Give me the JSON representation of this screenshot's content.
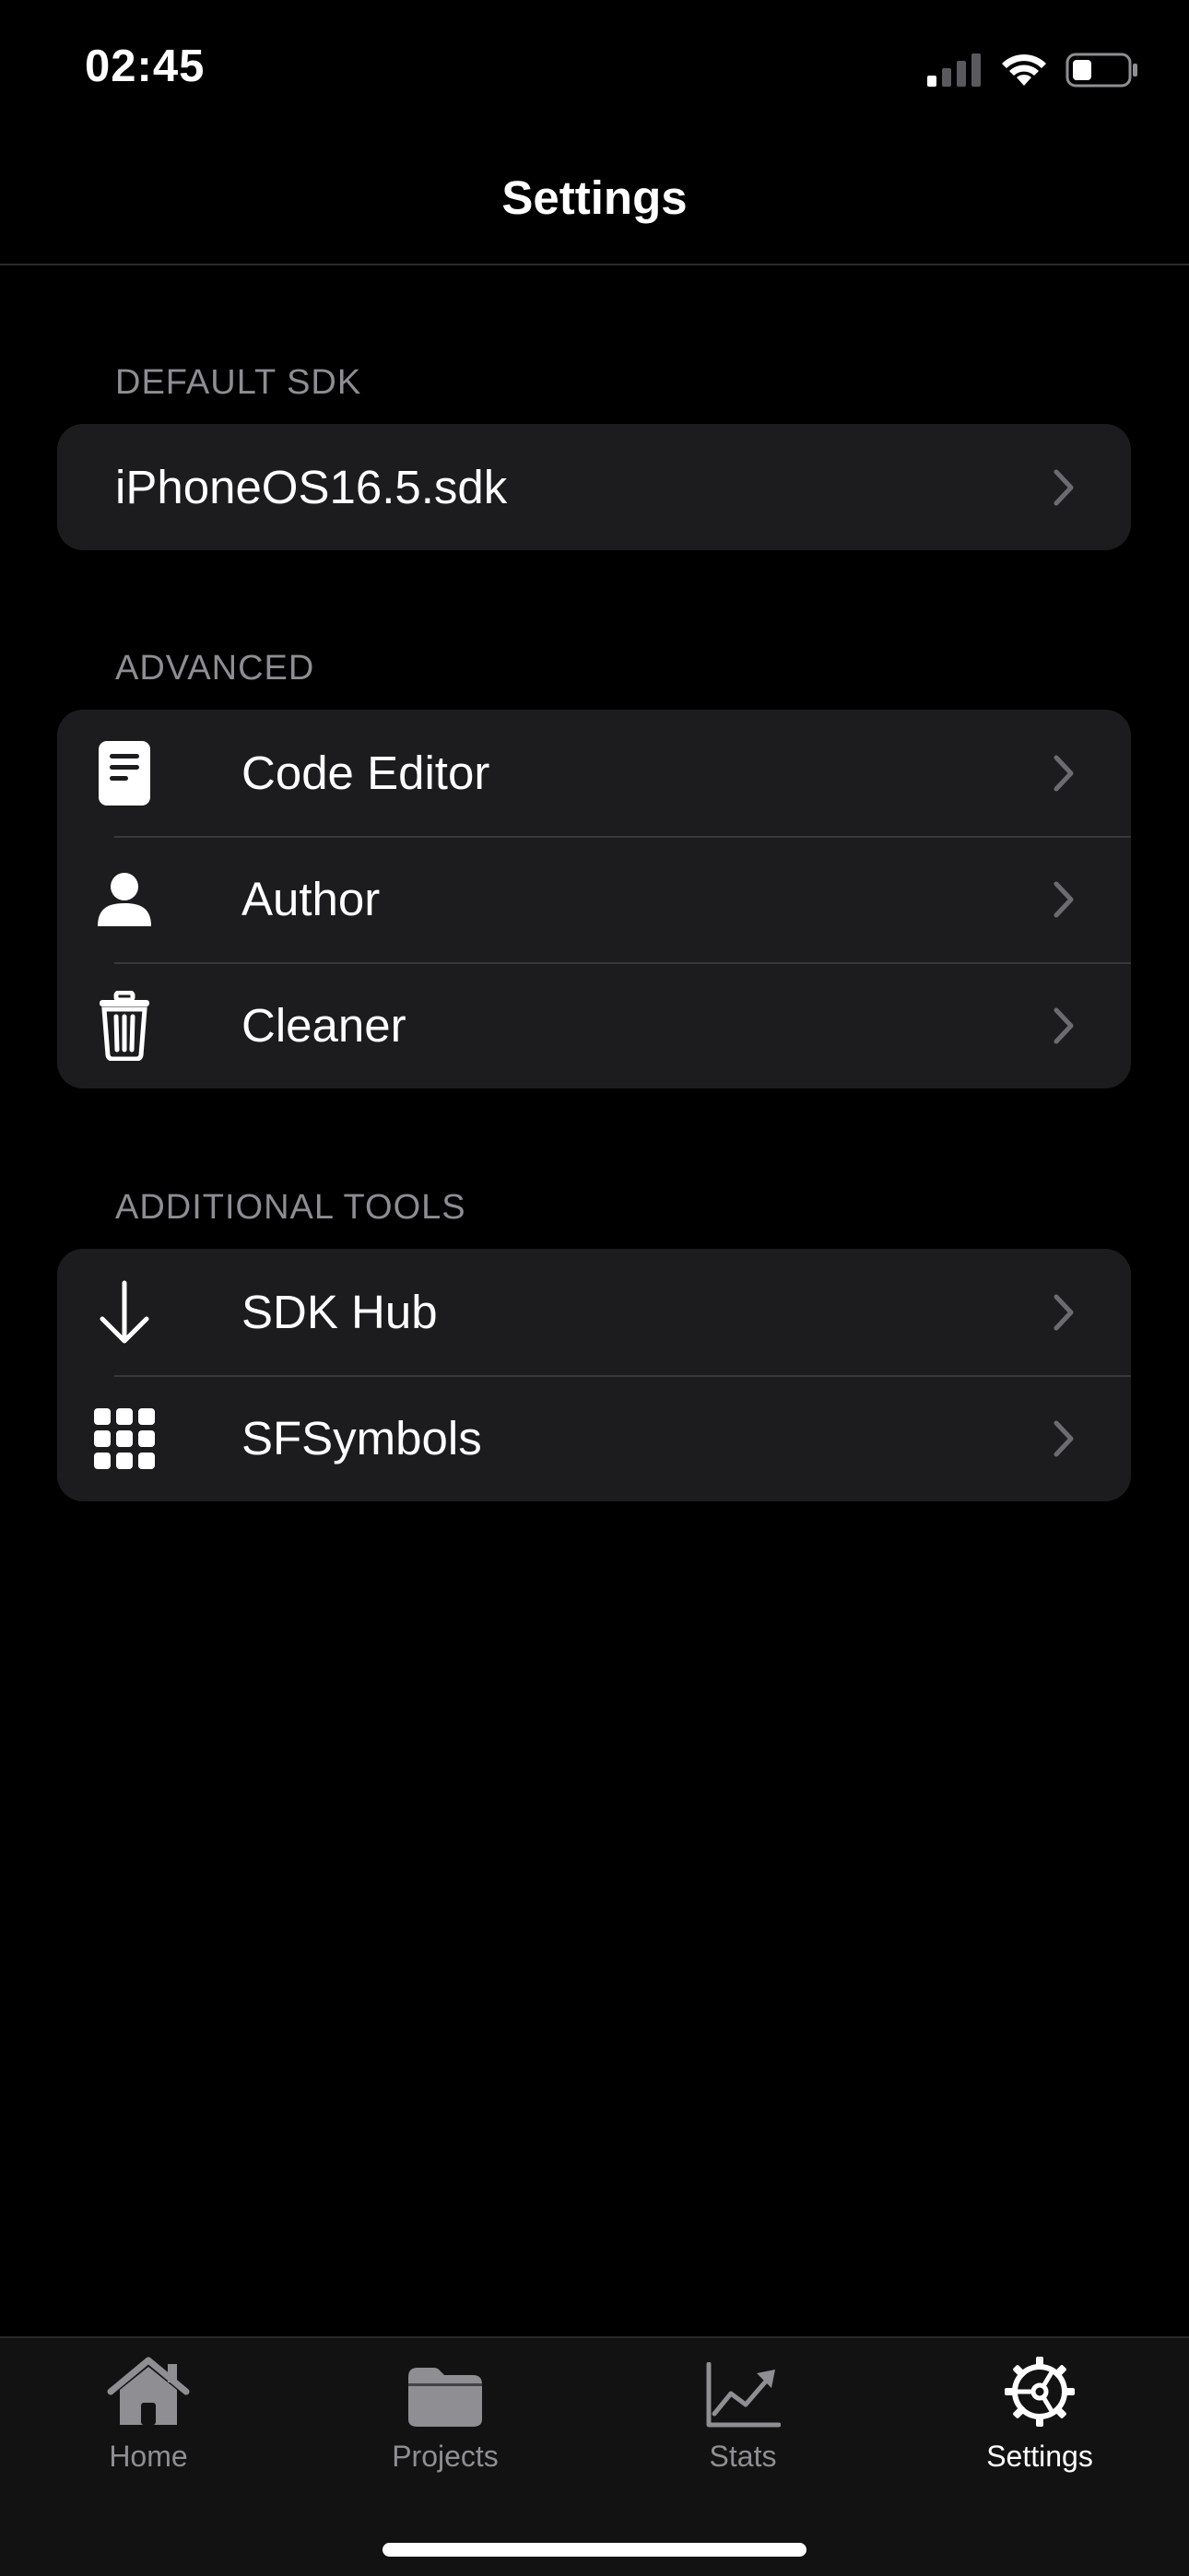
{
  "status_bar": {
    "time": "02:45",
    "icons": [
      "signal-icon",
      "wifi-icon",
      "battery-icon"
    ]
  },
  "nav": {
    "title": "Settings"
  },
  "sections": {
    "default_sdk": {
      "header": "DEFAULT SDK",
      "rows": [
        {
          "label": "iPhoneOS16.5.sdk"
        }
      ]
    },
    "advanced": {
      "header": "ADVANCED",
      "rows": [
        {
          "label": "Code Editor",
          "icon": "document-icon"
        },
        {
          "label": "Author",
          "icon": "person-icon"
        },
        {
          "label": "Cleaner",
          "icon": "trash-icon"
        }
      ]
    },
    "additional_tools": {
      "header": "ADDITIONAL TOOLS",
      "rows": [
        {
          "label": "SDK Hub",
          "icon": "arrow-down-icon"
        },
        {
          "label": "SFSymbols",
          "icon": "grid-icon"
        }
      ]
    }
  },
  "tabbar": {
    "tabs": [
      {
        "label": "Home",
        "icon": "house-icon",
        "active": false
      },
      {
        "label": "Projects",
        "icon": "folder-icon",
        "active": false
      },
      {
        "label": "Stats",
        "icon": "chart-icon",
        "active": false
      },
      {
        "label": "Settings",
        "icon": "gear-icon",
        "active": true
      }
    ]
  },
  "colors": {
    "background": "#000000",
    "cell": "#1c1c1e",
    "separator": "#38383a",
    "section_header": "#8d8d93",
    "tab_inactive": "#8e8e93",
    "tab_active": "#ffffff"
  }
}
